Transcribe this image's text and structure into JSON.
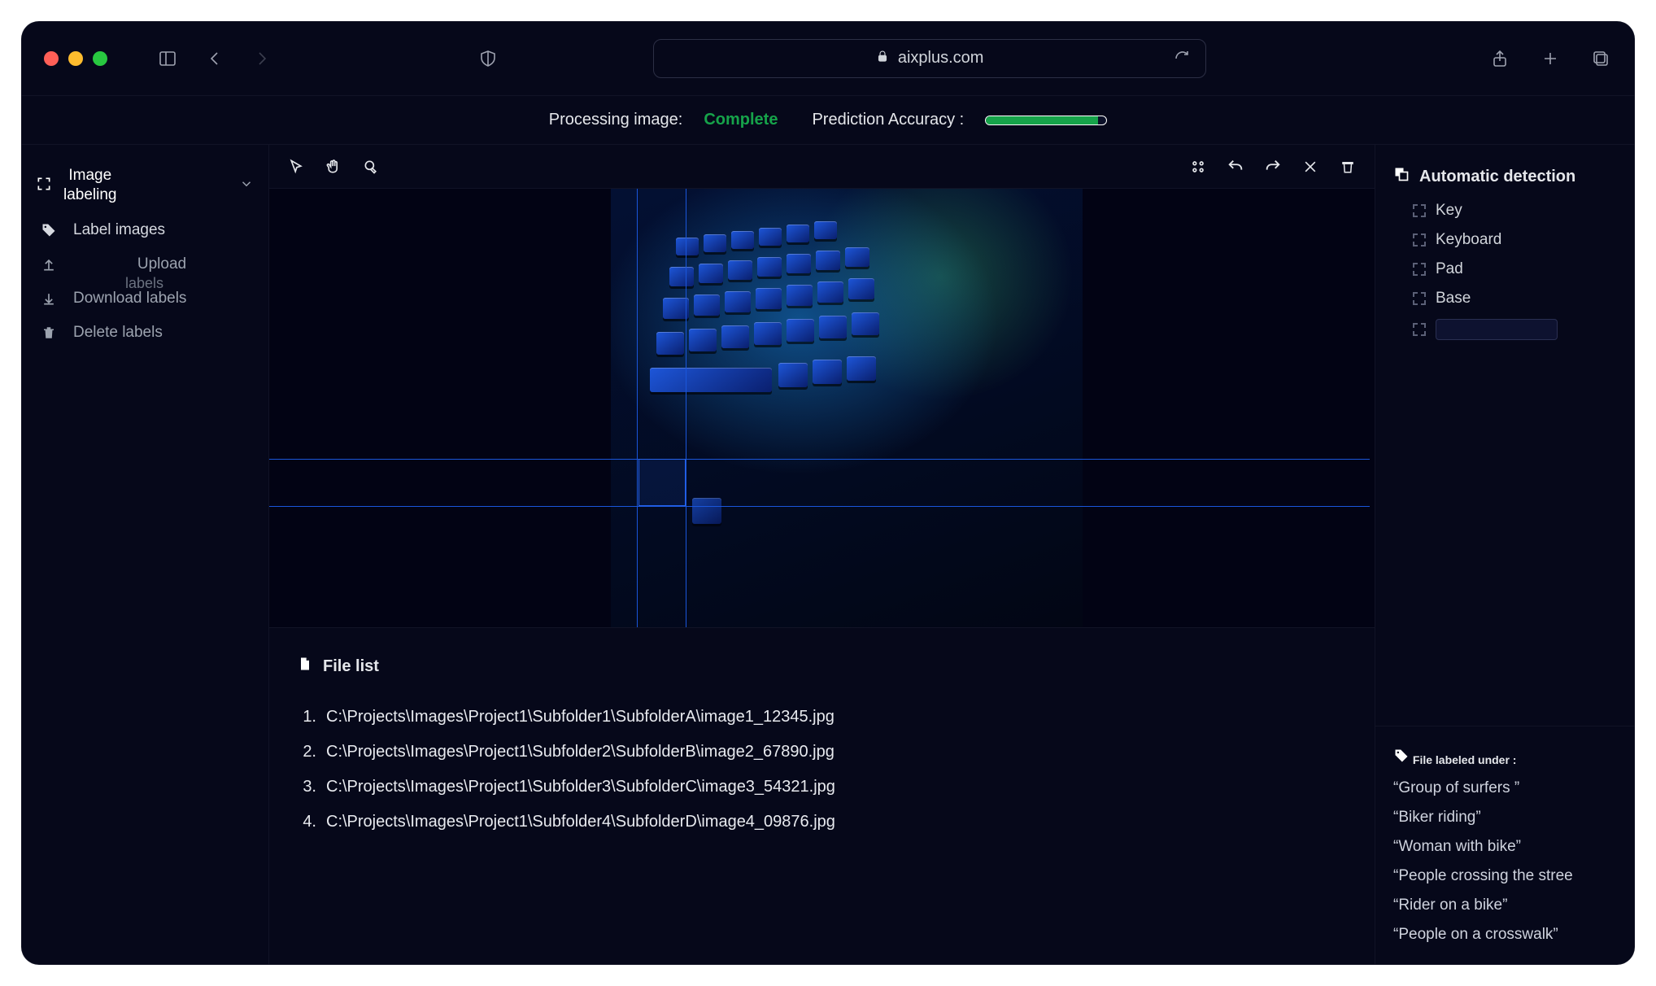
{
  "chrome": {
    "address": "aixplus.com"
  },
  "status": {
    "processing_label": "Processing image:",
    "processing_value": "Complete",
    "accuracy_label": "Prediction Accuracy :",
    "accuracy_pct": 93
  },
  "sidebar": {
    "title": "Image\nlabeling",
    "items": [
      {
        "icon": "tag",
        "label": "Label images"
      },
      {
        "icon": "upload",
        "label": "Upload"
      },
      {
        "icon": "download",
        "label": "Download labels",
        "sublabel": "labels"
      },
      {
        "icon": "trash",
        "label": "Delete labels"
      }
    ]
  },
  "detection": {
    "title": "Automatic detection",
    "labels": [
      "Key",
      "Keyboard",
      "Pad",
      "Base"
    ],
    "new_label_value": ""
  },
  "file_labels": {
    "title": "File labeled under :",
    "tags": [
      "“Group of surfers ”",
      "“Biker riding”",
      "“Woman with bike”",
      "“People crossing the stree",
      "“Rider on a bike”",
      "“People on a crosswalk”"
    ]
  },
  "filelist": {
    "title": "File list",
    "files": [
      "C:\\Projects\\Images\\Project1\\Subfolder1\\SubfolderA\\image1_12345.jpg",
      "C:\\Projects\\Images\\Project1\\Subfolder2\\SubfolderB\\image2_67890.jpg",
      "C:\\Projects\\Images\\Project1\\Subfolder3\\SubfolderC\\image3_54321.jpg",
      "C:\\Projects\\Images\\Project1\\Subfolder4\\SubfolderD\\image4_09876.jpg"
    ]
  }
}
